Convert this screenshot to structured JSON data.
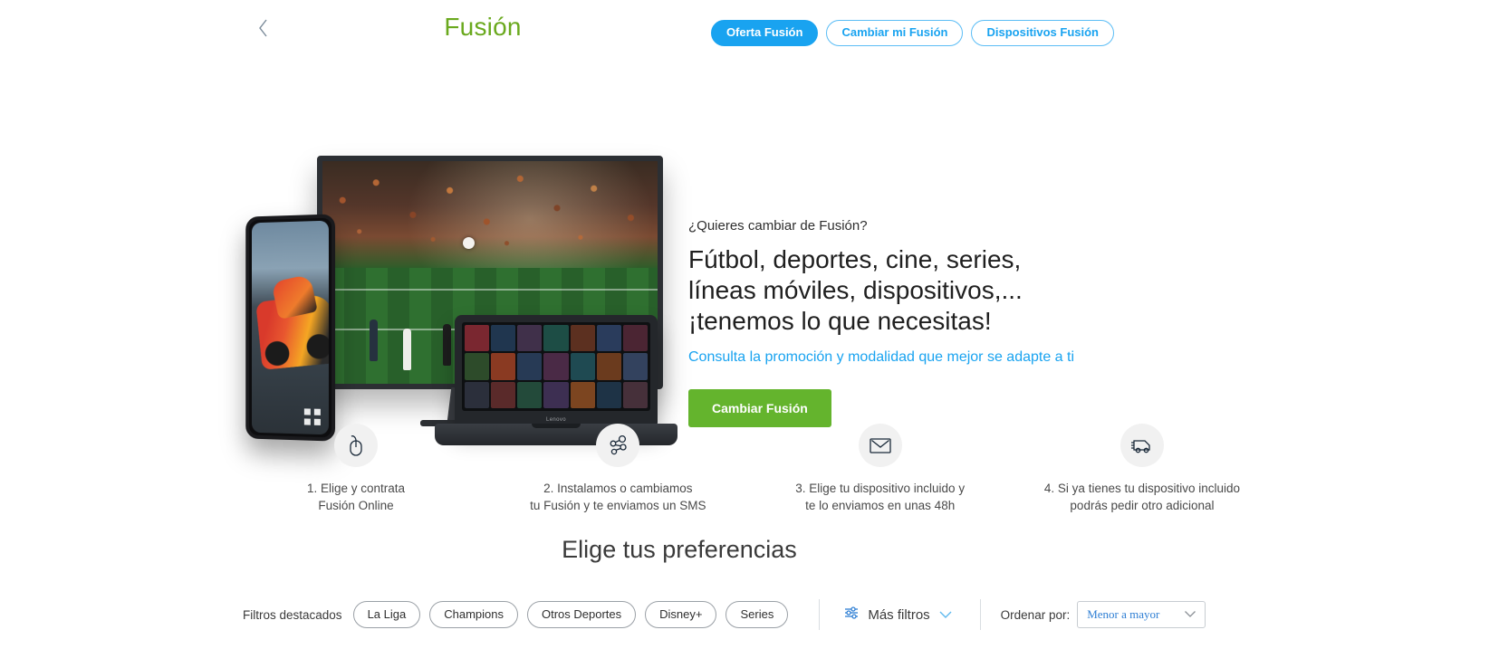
{
  "header": {
    "back_icon": "chevron-left-icon",
    "title": "Fusión",
    "nav_pills": [
      {
        "label": "Oferta Fusión",
        "style": "solid"
      },
      {
        "label": "Cambiar mi Fusión",
        "style": "outline"
      },
      {
        "label": "Dispositivos Fusión",
        "style": "outline"
      }
    ]
  },
  "hero": {
    "eyebrow": "¿Quieres cambiar de Fusión?",
    "headline": "Fútbol, deportes, cine, series, líneas móviles, dispositivos,... ¡tenemos lo que necesitas!",
    "sublink": "Consulta la promoción y modalidad que mejor se adapte a ti",
    "cta_label": "Cambiar Fusión",
    "laptop_brand": "Lenovo"
  },
  "steps": [
    {
      "icon": "mouse-icon",
      "line1": "1. Elige y contrata",
      "line2": "Fusión Online"
    },
    {
      "icon": "network-nodes-icon",
      "line1": "2. Instalamos o cambiamos",
      "line2": "tu Fusión y te enviamos un SMS"
    },
    {
      "icon": "envelope-icon",
      "line1": "3. Elige tu dispositivo incluido y",
      "line2": "te lo enviamos en unas 48h"
    },
    {
      "icon": "delivery-truck-icon",
      "line1": "4. Si ya tienes tu dispositivo incluido",
      "line2": "podrás pedir otro adicional"
    }
  ],
  "preferences": {
    "title": "Elige tus preferencias",
    "filters_label": "Filtros destacados",
    "chips": [
      "La Liga",
      "Champions",
      "Otros Deportes",
      "Disney+",
      "Series"
    ],
    "more_filters_label": "Más filtros",
    "sort_label": "Ordenar por:",
    "sort_value": "Menor a mayor"
  },
  "colors": {
    "brand_green": "#6aa91e",
    "cta_green": "#64b42d",
    "accent_blue": "#19a3f0",
    "link_blue": "#2f7fd4"
  }
}
